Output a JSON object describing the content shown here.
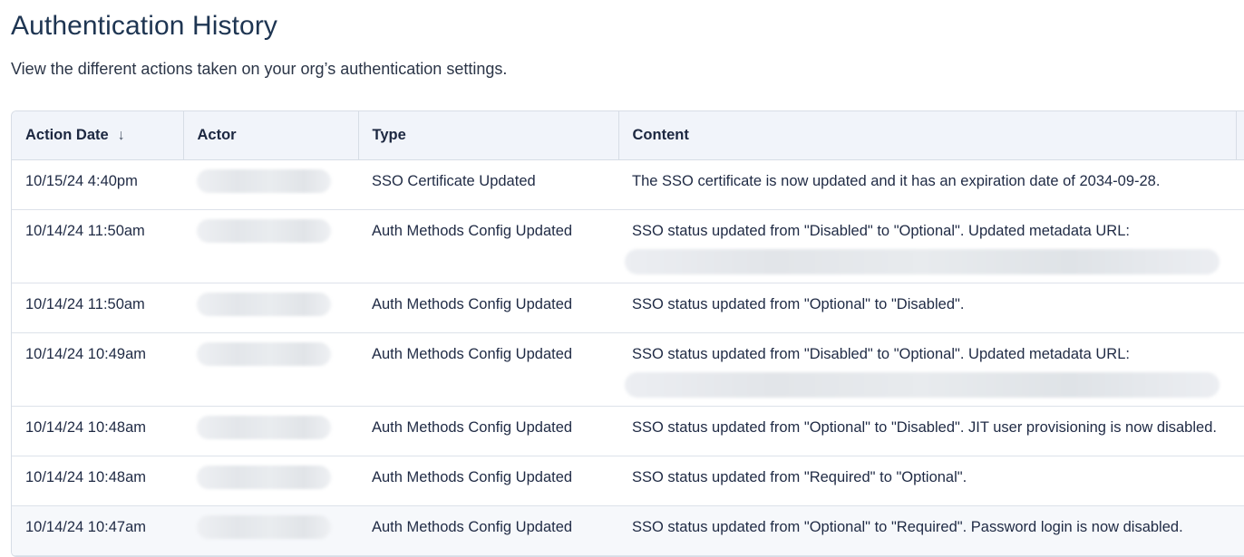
{
  "page": {
    "title": "Authentication History",
    "subtitle": "View the different actions taken on your org’s authentication settings."
  },
  "table": {
    "columns": {
      "action_date": "Action Date",
      "actor": "Actor",
      "type": "Type",
      "content": "Content"
    },
    "sort": {
      "column": "action_date",
      "direction": "descending",
      "icon": "arrow-down-icon",
      "glyph": "↓"
    },
    "rows": [
      {
        "date": "10/15/24 4:40pm",
        "type": "SSO Certificate Updated",
        "content": "The SSO certificate is now updated and it has an expiration date of 2034-09-28.",
        "url_redacted": false
      },
      {
        "date": "10/14/24 11:50am",
        "type": "Auth Methods Config Updated",
        "content": "SSO status updated from \"Disabled\" to \"Optional\". Updated metadata URL:",
        "url_redacted": true
      },
      {
        "date": "10/14/24 11:50am",
        "type": "Auth Methods Config Updated",
        "content": "SSO status updated from \"Optional\" to \"Disabled\".",
        "url_redacted": false
      },
      {
        "date": "10/14/24 10:49am",
        "type": "Auth Methods Config Updated",
        "content": "SSO status updated from \"Disabled\" to \"Optional\". Updated metadata URL:",
        "url_redacted": true
      },
      {
        "date": "10/14/24 10:48am",
        "type": "Auth Methods Config Updated",
        "content": "SSO status updated from \"Optional\" to \"Disabled\". JIT user provisioning is now disabled.",
        "url_redacted": false
      },
      {
        "date": "10/14/24 10:48am",
        "type": "Auth Methods Config Updated",
        "content": "SSO status updated from \"Required\" to \"Optional\".",
        "url_redacted": false
      },
      {
        "date": "10/14/24 10:47am",
        "type": "Auth Methods Config Updated",
        "content": "SSO status updated from \"Optional\" to \"Required\". Password login is now disabled.",
        "url_redacted": false
      }
    ]
  },
  "colors": {
    "title": "#1e3552",
    "header_bg": "#f1f4fa",
    "border": "#d7dde6",
    "text": "#1f2a44"
  }
}
